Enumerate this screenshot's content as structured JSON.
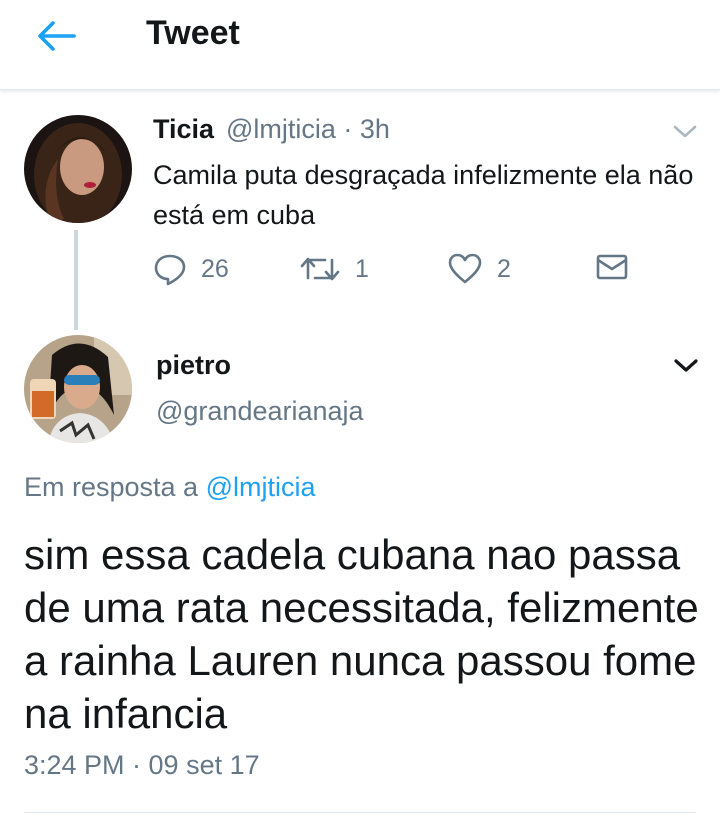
{
  "header": {
    "title": "Tweet",
    "back_icon": "arrow-left-icon",
    "accent": "#1da1f2"
  },
  "parent_tweet": {
    "name": "Ticia",
    "meta": "@lmjticia · 3h",
    "text": "Camila puta desgraçada infelizmente ela não está em cuba",
    "replies": "26",
    "retweets": "1",
    "likes": "2"
  },
  "main_tweet": {
    "name": "pietro",
    "handle": "@grandearianaja",
    "reply_prefix": "Em resposta a",
    "reply_to": "@lmjticia",
    "text": "sim essa cadela cubana nao passa de uma rata necessitada, felizmente a rainha Lauren nunca passou fome na infancia",
    "timestamp": "3:24 PM · 09 set 17"
  },
  "colors": {
    "text_primary": "#14171a",
    "text_secondary": "#657786",
    "link": "#1da1f2",
    "divider": "#e1e8ed",
    "thread_line": "#ccd6dd"
  }
}
